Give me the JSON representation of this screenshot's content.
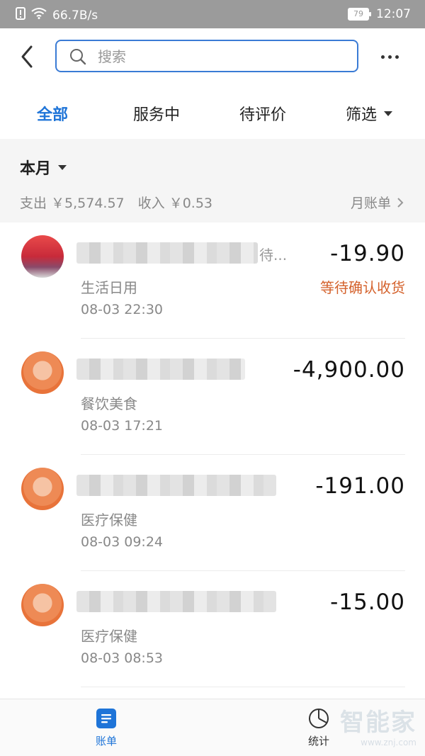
{
  "status_bar": {
    "net_speed": "66.7B/s",
    "battery": "79",
    "time": "12:07"
  },
  "search": {
    "placeholder": "搜索"
  },
  "tabs": [
    {
      "label": "全部",
      "active": true
    },
    {
      "label": "服务中",
      "active": false
    },
    {
      "label": "待评价",
      "active": false
    },
    {
      "label": "筛选",
      "active": false
    }
  ],
  "period": {
    "label": "本月",
    "summary": "支出 ￥5,574.57　收入 ￥0.53",
    "monthly_bill": "月账单"
  },
  "transactions": [
    {
      "title_tail": "待...",
      "category": "生活日用",
      "time": "08-03  22:30",
      "amount": "-19.90",
      "status": "等待确认收货"
    },
    {
      "category": "餐饮美食",
      "time": "08-03  17:21",
      "amount": "-4,900.00"
    },
    {
      "category": "医疗保健",
      "time": "08-03  09:24",
      "amount": "-191.00"
    },
    {
      "category": "医疗保健",
      "time": "08-03  08:53",
      "amount": "-15.00"
    }
  ],
  "bottom_nav": [
    {
      "label": "账单",
      "active": true
    },
    {
      "label": "统计",
      "active": false
    }
  ],
  "watermark": {
    "text": "智能家",
    "url": "www.znj.com"
  },
  "colors": {
    "accent": "#1e74d8",
    "status_orange": "#d4612b",
    "avatar_orange": "#e8733a"
  }
}
